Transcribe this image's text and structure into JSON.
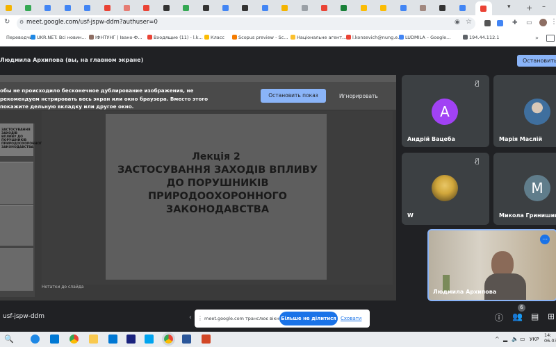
{
  "browser": {
    "url": "meet.google.com/usf-jspw-ddm?authuser=0",
    "bookmarks": [
      {
        "label": "Переводчик",
        "color": "#ffffff"
      },
      {
        "label": "UKR.NET: Всі новин...",
        "color": "#1e88e5"
      },
      {
        "label": "ІФНТУНГ | Івано-Ф...",
        "color": "#8d6e63"
      },
      {
        "label": "Входящие (11) - l.k...",
        "color": "#ea4335"
      },
      {
        "label": "Класс",
        "color": "#fbbc04"
      },
      {
        "label": "Scopus preview - Sc...",
        "color": "#f57c00"
      },
      {
        "label": "Національне агент...",
        "color": "#fbc02d"
      },
      {
        "label": "l.konsevich@nung.e...",
        "color": "#ea4335"
      },
      {
        "label": "LUDMILA – Google...",
        "color": "#4285f4"
      },
      {
        "label": "194.44.112.1",
        "color": "#5f6368"
      }
    ],
    "tab_colors": [
      "#f4b400",
      "#34a853",
      "#4285f4",
      "#4285f4",
      "#4285f4",
      "#ea4335",
      "#e67c73",
      "#ea4335",
      "#333333",
      "#34a853",
      "#333333",
      "#4285f4",
      "#333333",
      "#4285f4",
      "#f4b400",
      "#9aa0a6",
      "#ea4335",
      "#188038",
      "#fbbc04",
      "#fbbc04",
      "#4285f4",
      "#a1887f",
      "#333333",
      "#4285f4",
      "#ea4335"
    ]
  },
  "meet": {
    "presenter_label": "Людмила Архипова (вы, на главном экране)",
    "stop_button_top": "Остановить",
    "warning_text": "обы не происходило бесконечное дублирование изображения, не рекомендуем нстрировать весь экран или окно браузера. Вместо этого покажите дельную вкладку или другое окно.",
    "stop_show_button": "Остановить показ",
    "ignore_button": "Игнорировать",
    "meeting_code": "usf-jspw-ddm",
    "participants": [
      {
        "name": "Андрій Вацеба",
        "initial": "А",
        "avatar_color": "#a142f4",
        "muted": true
      },
      {
        "name": "Марія Маслій",
        "initial": "",
        "avatar_color": "#6d8aa8",
        "muted": false
      },
      {
        "name": "W",
        "initial": "",
        "avatar_color": "#c9a227",
        "muted": true
      },
      {
        "name": "Микола Гринишин",
        "initial": "М",
        "avatar_color": "#607d8b",
        "muted": false
      },
      {
        "name": "Людмила Архипова",
        "initial": "",
        "avatar_color": "#b8a890",
        "muted": false
      }
    ],
    "participant_count": "6",
    "share_notice": "meet.google.com транслює вікно.",
    "no_share_button": "Більше не ділитися",
    "hide_link": "Сховати"
  },
  "slide": {
    "lecture": "Лекція 2",
    "title": "ЗАСТОСУВАННЯ ЗАХОДІВ ВПЛИВУ ДО ПОРУШНИКІВ ПРИРОДООХОРОННОГО ЗАКОНОДАВСТВА",
    "thumb_title": "ЗАСТОСУВАННЯ ЗАХОДІВ ВПЛИВУ ДО ПОРУШНИКІВ ПРИРОДООХОРОННОГО ЗАКОНОДАВСТВА",
    "notes_placeholder": "Нотатки до слайда"
  },
  "taskbar": {
    "language": "УКР",
    "time": "14:",
    "date": "06.03."
  }
}
